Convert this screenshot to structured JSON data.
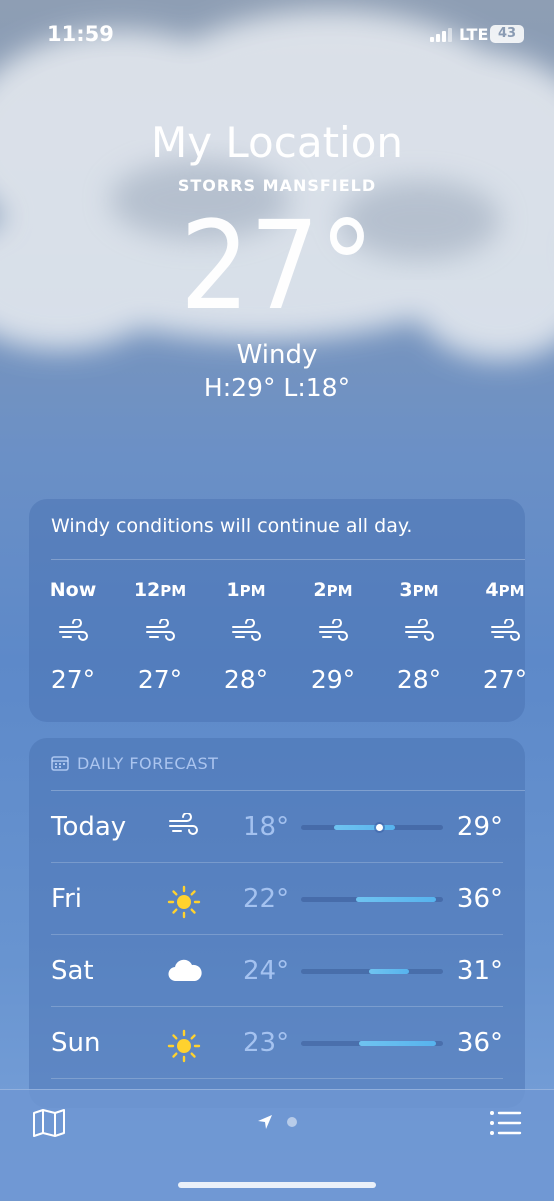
{
  "status_bar": {
    "time": "11:59",
    "network": "LTE",
    "battery": "43"
  },
  "header": {
    "location": "My Location",
    "sublocation": "STORRS MANSFIELD",
    "temperature": "27°",
    "condition": "Windy",
    "high_low": "H:29°  L:18°"
  },
  "hourly": {
    "message": "Windy conditions will continue all day.",
    "hours": [
      {
        "time": "Now",
        "suffix": "",
        "icon": "wind-icon",
        "temp": "27°"
      },
      {
        "time": "12",
        "suffix": "PM",
        "icon": "wind-icon",
        "temp": "27°"
      },
      {
        "time": "1",
        "suffix": "PM",
        "icon": "wind-icon",
        "temp": "28°"
      },
      {
        "time": "2",
        "suffix": "PM",
        "icon": "wind-icon",
        "temp": "29°"
      },
      {
        "time": "3",
        "suffix": "PM",
        "icon": "wind-icon",
        "temp": "28°"
      },
      {
        "time": "4",
        "suffix": "PM",
        "icon": "wind-icon",
        "temp": "27°"
      }
    ]
  },
  "daily": {
    "header": "DAILY FORECAST",
    "days": [
      {
        "day": "Today",
        "icon": "wind-icon",
        "low": "18°",
        "high": "29°",
        "range_start": 0.23,
        "range_end": 0.66,
        "current": 0.55
      },
      {
        "day": "Fri",
        "icon": "sun-icon",
        "low": "22°",
        "high": "36°",
        "range_start": 0.39,
        "range_end": 0.95
      },
      {
        "day": "Sat",
        "icon": "cloud-icon",
        "low": "24°",
        "high": "31°",
        "range_start": 0.48,
        "range_end": 0.76
      },
      {
        "day": "Sun",
        "icon": "sun-icon",
        "low": "23°",
        "high": "36°",
        "range_start": 0.41,
        "range_end": 0.95
      }
    ]
  },
  "colors": {
    "bar_fill": "#57b3ee",
    "low_temp": "#bed7ff"
  }
}
